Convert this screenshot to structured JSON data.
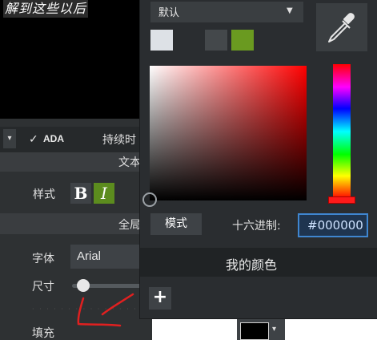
{
  "preview": {
    "caption": "解到这些以后"
  },
  "toolbar": {
    "collapse_icon": "▾",
    "ada_check": "✓",
    "ada_label": "ADA",
    "duration_label": "持续时"
  },
  "sections": {
    "text": "文本",
    "global": "全局"
  },
  "style_row": {
    "label": "样式",
    "bold": "B",
    "italic": "I"
  },
  "font_row": {
    "label": "字体",
    "value": "Arial"
  },
  "size_row": {
    "label": "尺寸",
    "value_fraction": 0.1
  },
  "fill_row": {
    "label": "填充",
    "color": "#000000",
    "arrow": "▾"
  },
  "picker": {
    "preset": {
      "value": "默认",
      "arrow": "▼"
    },
    "swatches": [
      "#dde1e6",
      "#44484b",
      "#6a9a20"
    ],
    "mode_button": "模式",
    "hex_label": "十六进制:",
    "hex_value": "#000000",
    "my_colors_label": "我的颜色",
    "add_button": "+"
  },
  "colors": {
    "accent_green": "#5c8c1e",
    "hex_border": "#3f86d0",
    "annotation_red": "#e02020"
  }
}
